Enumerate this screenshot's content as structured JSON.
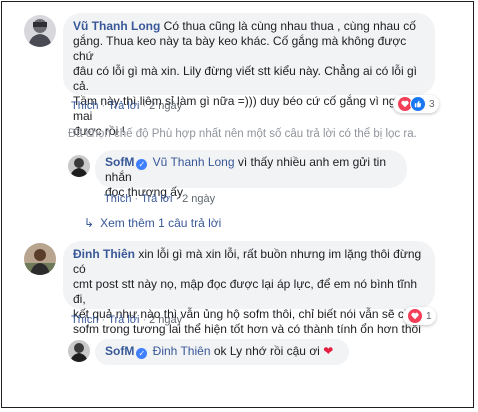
{
  "comments": [
    {
      "author": "Vũ Thanh Long",
      "text_lines": [
        "Có thua cũng là cùng nhau thua , cùng nhau cố",
        "gắng. Thua keo này ta bày keo khác. Cố gắng mà không được chứ",
        "đâu có lỗi gì mà xin. Lily đừng viết stt kiểu này. Chẳng ai có lỗi gì cả.",
        "Tầm này thì liêm sỉ làm gì nữa =))) duy béo cứ cố gắng vì ngày mai",
        "được rồi !"
      ],
      "like_label": "Thích",
      "reply_label": "Trả lời",
      "time": "2 ngày",
      "reaction_count": "3",
      "reaction_icons": [
        "heart-icon",
        "like-icon"
      ]
    },
    {
      "author": "Đinh Thiên",
      "text_lines": [
        "xin lỗi gì mà xin lỗi, rất buồn nhưng im lặng thôi đừng có",
        "cmt post stt này nọ, mập đọc được lại áp lực, để em nó bình tĩnh đi,",
        "kết quả như nào thì vẫn ủng hộ sofm thôi, chỉ biết nói vẫn sẽ chờ",
        "sofm trong tương lai thể hiện tốt hơn và có thành tính ổn hơn thôi"
      ],
      "like_label": "Thích",
      "reply_label": "Trả lời",
      "time": "2 ngày",
      "reaction_count": "1",
      "reaction_icons": [
        "heart-icon"
      ]
    }
  ],
  "filter_note": "Đã chọn chế độ Phù hợp nhất nên một số câu trả lời có thể bị lọc ra.",
  "reply1": {
    "author": "SofM",
    "mention": "Vũ Thanh Long",
    "text_line1": "vì thấy nhiều anh em gửi tin nhắn",
    "text_line2": "đọc thương ấy",
    "like_label": "Thích",
    "reply_label": "Trả lời",
    "time": "2 ngày"
  },
  "more_replies": "Xem thêm 1 câu trả lời",
  "reply2": {
    "author": "SofM",
    "mention": "Đinh Thiên",
    "text": "ok Ly nhớ rồi cậu ơi"
  },
  "verified_symbol": "✓",
  "reply_arrow": "↳",
  "heart_symbol": "❤",
  "colors": {
    "link": "#385898",
    "bubble": "#f2f3f5",
    "meta": "#606770",
    "heart": "#f33e58",
    "like": "#1877f2",
    "verified": "#4080ff"
  }
}
